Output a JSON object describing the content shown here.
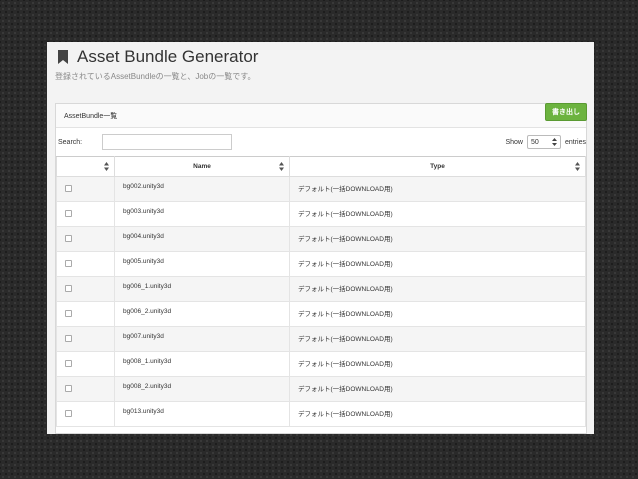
{
  "header": {
    "title": "Asset Bundle Generator",
    "subtitle": "登録されているAssetBundleの一覧と、Jobの一覧です。"
  },
  "panel": {
    "title": "AssetBundle一覧",
    "export_label": "書き出し"
  },
  "controls": {
    "search_label": "Search:",
    "search_value": "",
    "show_label": "Show",
    "length_value": "50",
    "entries_label": "entries"
  },
  "table": {
    "columns": [
      "",
      "Name",
      "Type"
    ],
    "rows": [
      {
        "name": "bg002.unity3d",
        "type": "デフォルト(一括DOWNLOAD用)"
      },
      {
        "name": "bg003.unity3d",
        "type": "デフォルト(一括DOWNLOAD用)"
      },
      {
        "name": "bg004.unity3d",
        "type": "デフォルト(一括DOWNLOAD用)"
      },
      {
        "name": "bg005.unity3d",
        "type": "デフォルト(一括DOWNLOAD用)"
      },
      {
        "name": "bg006_1.unity3d",
        "type": "デフォルト(一括DOWNLOAD用)"
      },
      {
        "name": "bg006_2.unity3d",
        "type": "デフォルト(一括DOWNLOAD用)"
      },
      {
        "name": "bg007.unity3d",
        "type": "デフォルト(一括DOWNLOAD用)"
      },
      {
        "name": "bg008_1.unity3d",
        "type": "デフォルト(一括DOWNLOAD用)"
      },
      {
        "name": "bg008_2.unity3d",
        "type": "デフォルト(一括DOWNLOAD用)"
      },
      {
        "name": "bg013.unity3d",
        "type": "デフォルト(一括DOWNLOAD用)"
      }
    ]
  },
  "icons": {
    "title_icon": "bookmark-icon",
    "sort_icon": "sort-icon",
    "select_icon": "updown-icon"
  },
  "colors": {
    "export_button": "#6cb33f",
    "odd_row": "#f5f5f5"
  }
}
